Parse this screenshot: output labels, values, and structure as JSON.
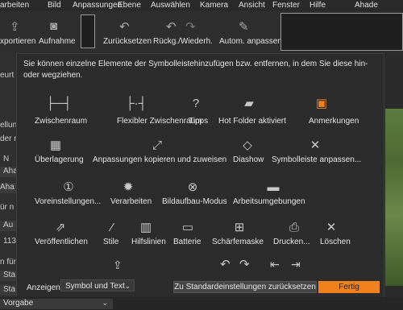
{
  "menu": [
    "arbeiten",
    "Bild",
    "Anpassungen",
    "Ebene",
    "Auswählen",
    "Kamera",
    "Ansicht",
    "Fenster",
    "Hilfe",
    "Ahade"
  ],
  "toolbar": {
    "export_label": "xportieren",
    "capture_label": "Aufnahme",
    "reset_label": "Zurücksetzen",
    "undo_redo_label": "Rückg./Wiederh.",
    "auto_adjust_label": "Autom. anpassen"
  },
  "left_panel": {
    "rows": [
      "eurt",
      "ellung",
      "der n",
      "N",
      "Aha",
      "Aha",
      "ür n",
      "Au",
      "113C",
      "n für",
      "Sta",
      "Sta",
      "Vorgabe"
    ]
  },
  "dialog": {
    "description": "Sie können einzelne Elemente der Symbolleistehinzufügen bzw. entfernen, in dem Sie diese hin- oder wegziehen.",
    "items": [
      {
        "label": "Zwischenraum",
        "icon": "space-icon"
      },
      {
        "label": "Flexibler Zwischenraum",
        "icon": "flexible-space-icon"
      },
      {
        "label": "Tipps",
        "icon": "question-icon"
      },
      {
        "label": "Hot Folder aktiviert",
        "icon": "hot-folder-icon"
      },
      {
        "label": "Anmerkungen",
        "icon": "annotation-icon"
      },
      {
        "label": "Überlagerung",
        "icon": "overlay-icon"
      },
      {
        "label": "Anpassungen kopieren und zuweisen",
        "icon": "copy-apply-icon"
      },
      {
        "label": "Diashow",
        "icon": "slideshow-icon"
      },
      {
        "label": "Symbolleiste anpassen...",
        "icon": "tools-icon"
      },
      {
        "label": "Voreinstellungen...",
        "icon": "preferences-icon"
      },
      {
        "label": "Verarbeiten",
        "icon": "gear-icon"
      },
      {
        "label": "Bildaufbau-Modus",
        "icon": "composition-icon"
      },
      {
        "label": "Arbeitsumgebungen",
        "icon": "workspace-icon"
      },
      {
        "label": "Veröffentlichen",
        "icon": "publish-icon"
      },
      {
        "label": "Stile",
        "icon": "brush-icon"
      },
      {
        "label": "Hilfslinien",
        "icon": "guides-icon"
      },
      {
        "label": "Batterie",
        "icon": "battery-icon"
      },
      {
        "label": "Schärfemaske",
        "icon": "focus-mask-icon"
      },
      {
        "label": "Drucken...",
        "icon": "print-icon"
      },
      {
        "label": "Löschen",
        "icon": "close-icon"
      }
    ],
    "show_label": "Anzeigen",
    "show_value": "Symbol und Text",
    "reset_defaults_label": "Zu Standardeinstellungen zurücksetzen",
    "done_label": "Fertig"
  },
  "colors": {
    "accent": "#f0811c",
    "background": "#2c2c2c"
  }
}
